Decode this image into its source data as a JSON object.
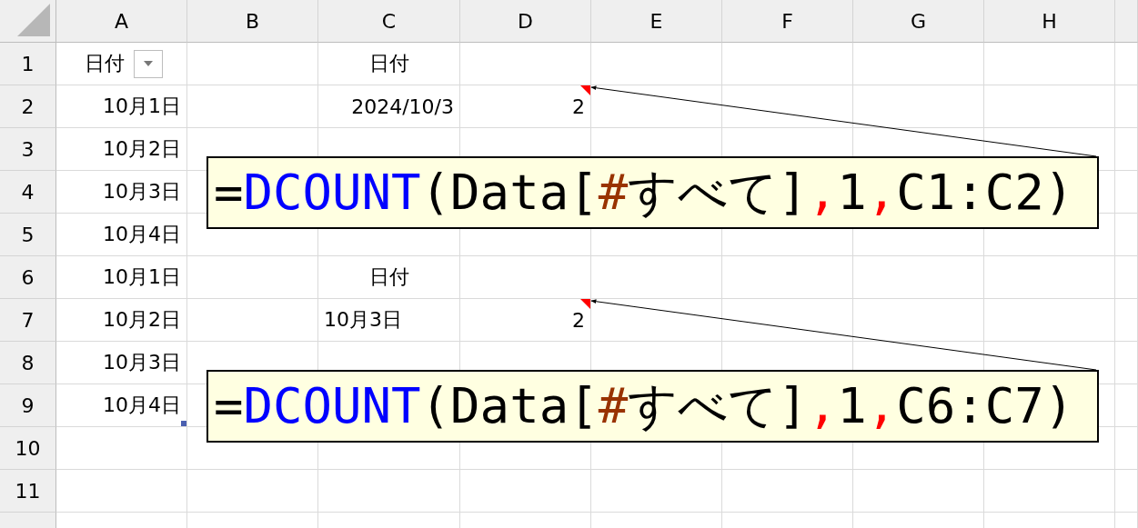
{
  "sheet": {
    "columns": [
      "A",
      "B",
      "C",
      "D",
      "E",
      "F",
      "G",
      "H"
    ],
    "rows": [
      {
        "number": "1",
        "cells": [
          {
            "text": "日付",
            "kind": "header",
            "filter_button": true
          },
          null,
          {
            "text": "日付",
            "kind": "header"
          },
          null,
          null,
          null,
          null,
          null
        ]
      },
      {
        "number": "2",
        "cells": [
          {
            "text": "10月1日",
            "kind": "date"
          },
          null,
          {
            "text": "2024/10/3",
            "kind": "date"
          },
          {
            "text": "2",
            "kind": "number",
            "comment": {
              "tokens": [
                {
                  "text": "=",
                  "color": "#000000"
                },
                {
                  "text": "DCOUNT",
                  "color": "#0000ff"
                },
                {
                  "text": "(Data[",
                  "color": "#000000"
                },
                {
                  "text": "#",
                  "color": "#993300"
                },
                {
                  "text": "すべて]",
                  "color": "#000000"
                },
                {
                  "text": ",",
                  "color": "#ff0000"
                },
                {
                  "text": "1",
                  "color": "#000000"
                },
                {
                  "text": ",",
                  "color": "#ff0000"
                },
                {
                  "text": "C1:C2)",
                  "color": "#000000"
                }
              ]
            }
          },
          null,
          null,
          null,
          null
        ]
      },
      {
        "number": "3",
        "cells": [
          {
            "text": "10月2日",
            "kind": "date"
          },
          null,
          null,
          null,
          null,
          null,
          null,
          null
        ]
      },
      {
        "number": "4",
        "cells": [
          {
            "text": "10月3日",
            "kind": "date"
          },
          null,
          null,
          null,
          null,
          null,
          null,
          null
        ]
      },
      {
        "number": "5",
        "cells": [
          {
            "text": "10月4日",
            "kind": "date"
          },
          null,
          null,
          null,
          null,
          null,
          null,
          null
        ]
      },
      {
        "number": "6",
        "cells": [
          {
            "text": "10月1日",
            "kind": "date"
          },
          null,
          {
            "text": "日付",
            "kind": "header"
          },
          null,
          null,
          null,
          null,
          null
        ]
      },
      {
        "number": "7",
        "cells": [
          {
            "text": "10月2日",
            "kind": "date"
          },
          null,
          {
            "text": "10月3日",
            "kind": "text"
          },
          {
            "text": "2",
            "kind": "number",
            "comment": {
              "tokens": [
                {
                  "text": "=",
                  "color": "#000000"
                },
                {
                  "text": "DCOUNT",
                  "color": "#0000ff"
                },
                {
                  "text": "(Data[",
                  "color": "#000000"
                },
                {
                  "text": "#",
                  "color": "#993300"
                },
                {
                  "text": "すべて]",
                  "color": "#000000"
                },
                {
                  "text": ",",
                  "color": "#ff0000"
                },
                {
                  "text": "1",
                  "color": "#000000"
                },
                {
                  "text": ",",
                  "color": "#ff0000"
                },
                {
                  "text": "C6:C7)",
                  "color": "#000000"
                }
              ]
            }
          },
          null,
          null,
          null,
          null
        ]
      },
      {
        "number": "8",
        "cells": [
          {
            "text": "10月3日",
            "kind": "date"
          },
          null,
          null,
          null,
          null,
          null,
          null,
          null
        ]
      },
      {
        "number": "9",
        "cells": [
          {
            "text": "10月4日",
            "kind": "date",
            "table_end": true
          },
          null,
          null,
          null,
          null,
          null,
          null,
          null
        ]
      },
      {
        "number": "10",
        "cells": [
          null,
          null,
          null,
          null,
          null,
          null,
          null,
          null
        ]
      },
      {
        "number": "11",
        "cells": [
          null,
          null,
          null,
          null,
          null,
          null,
          null,
          null
        ]
      }
    ]
  }
}
